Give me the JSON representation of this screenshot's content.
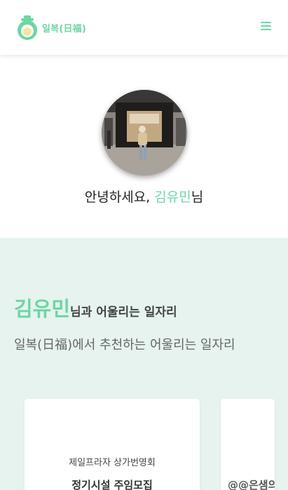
{
  "header": {
    "logo_text": "일복(日福)",
    "menu_icon": "hamburger-menu-icon",
    "accent_color": "#6dd6a5"
  },
  "profile": {
    "greeting_prefix": "안녕하세요, ",
    "user_name": "김유민",
    "greeting_suffix": "님"
  },
  "recommend": {
    "title_name": "김유민",
    "title_rest": "님과 어울리는 일자리",
    "subtitle": "일복(日福)에서 추천하는 어울리는 일자리",
    "background_color": "#e6f3ee",
    "cards": [
      {
        "org": "제일프라자 상가번영회",
        "title": "정기시설 주임모집"
      },
      {
        "title": "@@은샘의"
      }
    ]
  }
}
